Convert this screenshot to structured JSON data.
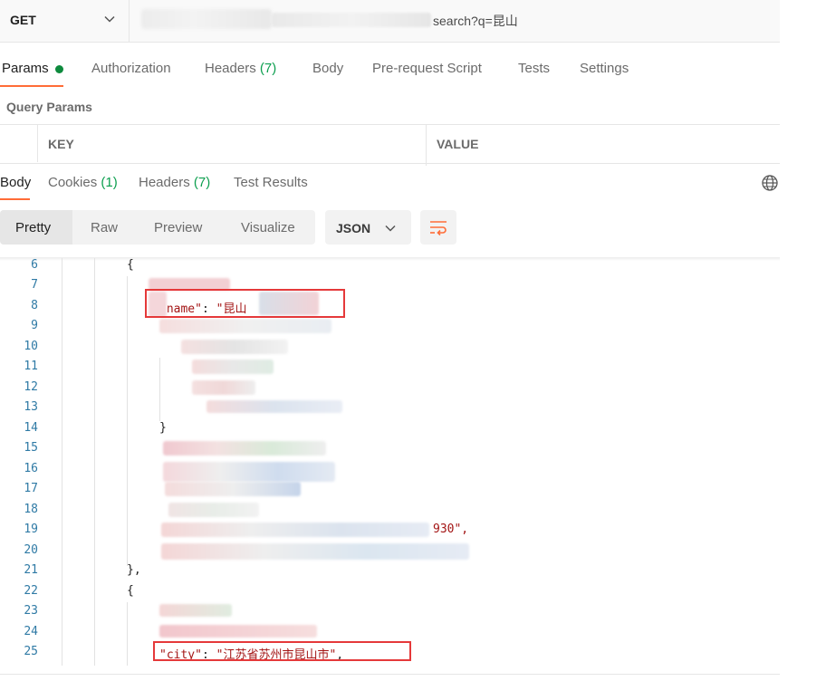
{
  "request": {
    "method": "GET",
    "url_visible_suffix": "search?q=昆山"
  },
  "request_tabs": [
    {
      "label": "Params",
      "active": true,
      "dot": true
    },
    {
      "label": "Authorization"
    },
    {
      "label": "Headers",
      "count": "(7)"
    },
    {
      "label": "Body"
    },
    {
      "label": "Pre-request Script"
    },
    {
      "label": "Tests"
    },
    {
      "label": "Settings"
    }
  ],
  "query_params": {
    "title": "Query Params",
    "columns": [
      "KEY",
      "VALUE"
    ]
  },
  "response_tabs": [
    {
      "label": "Body",
      "active": true
    },
    {
      "label": "Cookies",
      "count": "(1)"
    },
    {
      "label": "Headers",
      "count": "(7)"
    },
    {
      "label": "Test Results"
    }
  ],
  "view_modes": [
    "Pretty",
    "Raw",
    "Preview",
    "Visualize"
  ],
  "format": "JSON",
  "code": {
    "lines": [
      6,
      7,
      8,
      9,
      10,
      11,
      12,
      13,
      14,
      15,
      16,
      17,
      18,
      19,
      20,
      21,
      22,
      23,
      24,
      25
    ],
    "brace_open": "{",
    "name_key": "\"name\"",
    "colon": ": ",
    "name_value": "\"昆山",
    "brace_close": "}",
    "partial_19": "930\",",
    "close_obj": "},",
    "city_key": "\"city\"",
    "city_value": "\"江苏省苏州市昆山市\"",
    "comma": ","
  },
  "colors": {
    "accent": "#ff6c37",
    "count_green": "#0d9f4f",
    "highlight_red": "#e5393a",
    "line_number": "#2f7aa5",
    "string": "#a31515"
  }
}
